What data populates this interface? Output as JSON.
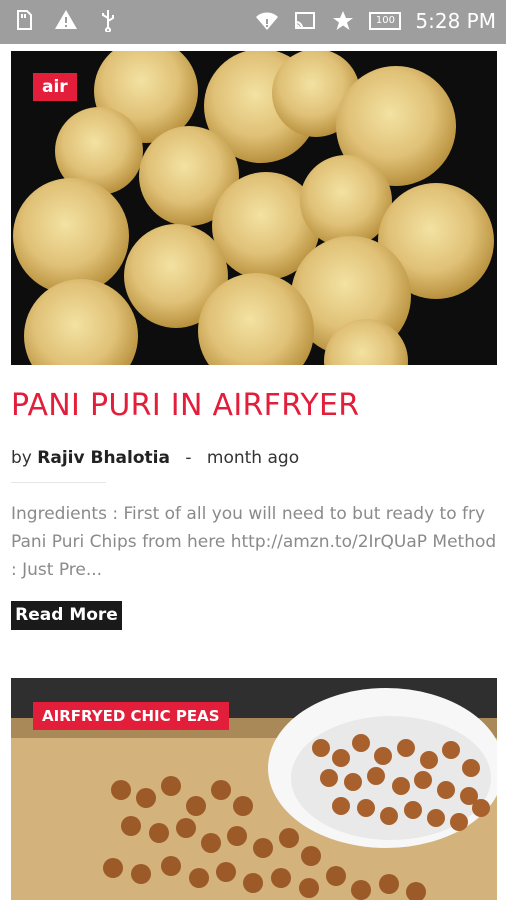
{
  "status_bar": {
    "time": "5:28 PM",
    "battery_label": "100",
    "icons_left": [
      "sd-card-icon",
      "warning-icon",
      "usb-icon"
    ],
    "icons_right": [
      "wifi-icon",
      "cast-icon",
      "star-icon",
      "battery-icon"
    ]
  },
  "colors": {
    "accent": "#e31e3a",
    "status_bar": "#9e9e9e",
    "button_bg": "#1a1a1a"
  },
  "posts": [
    {
      "tag": "air",
      "title": "PANI PURI IN AIRFRYER",
      "by_label": "by",
      "author": "Rajiv Bhalotia",
      "separator": "-",
      "time_ago": "month ago",
      "excerpt": "Ingredients : First of all you will need to but ready to fry Pani Puri Chips from here  http://amzn.to/2IrQUaP Method : Just Pre...",
      "read_more": "Read More"
    },
    {
      "tag": "AIRFRYED CHIC PEAS"
    }
  ]
}
